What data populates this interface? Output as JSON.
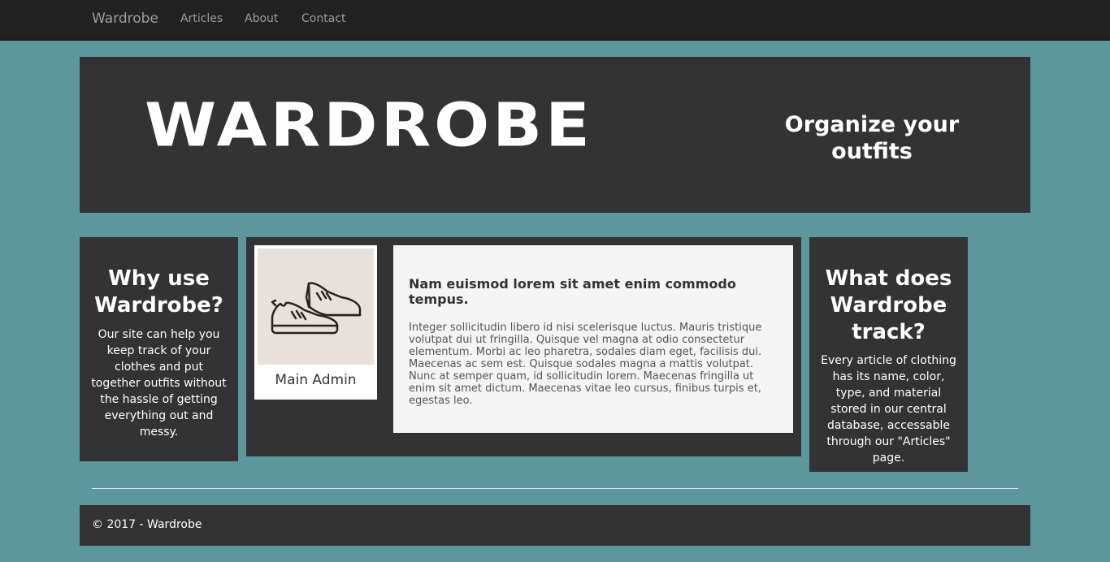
{
  "nav": {
    "brand": "Wardrobe",
    "links": [
      "Articles",
      "About",
      "Contact"
    ]
  },
  "hero": {
    "title": "WARDROBE",
    "tagline": "Organize your outfits"
  },
  "why": {
    "title": "Why use Wardrobe?",
    "text": "Our site can help you keep track of your clothes and put together outfits without the hassle of getting everything out and messy."
  },
  "profile": {
    "icon": "sneakers-icon",
    "name": "Main Admin"
  },
  "article": {
    "title": "Nam euismod lorem sit amet enim commodo tempus.",
    "body": "Integer sollicitudin libero id nisi scelerisque luctus. Mauris tristique volutpat dui ut fringilla. Quisque vel magna at odio consectetur elementum. Morbi ac leo pharetra, sodales diam eget, facilisis dui. Maecenas ac sem est. Quisque sodales magna a mattis volutpat. Nunc at semper quam, id sollicitudin lorem. Maecenas fringilla ut enim sit amet dictum. Maecenas vitae leo cursus, finibus turpis et, egestas leo."
  },
  "track": {
    "title": "What does Wardrobe track?",
    "text": "Every article of clothing has its name, color, type, and material stored in our central database, accessable through our \"Articles\" page."
  },
  "footer": {
    "text": "© 2017 - Wardrobe"
  },
  "colors": {
    "page_background": "#5b979d",
    "navbar": "#222222",
    "panels": "#333333",
    "article_background": "#f4f4f4",
    "profile_image_background": "#e8e0db"
  }
}
